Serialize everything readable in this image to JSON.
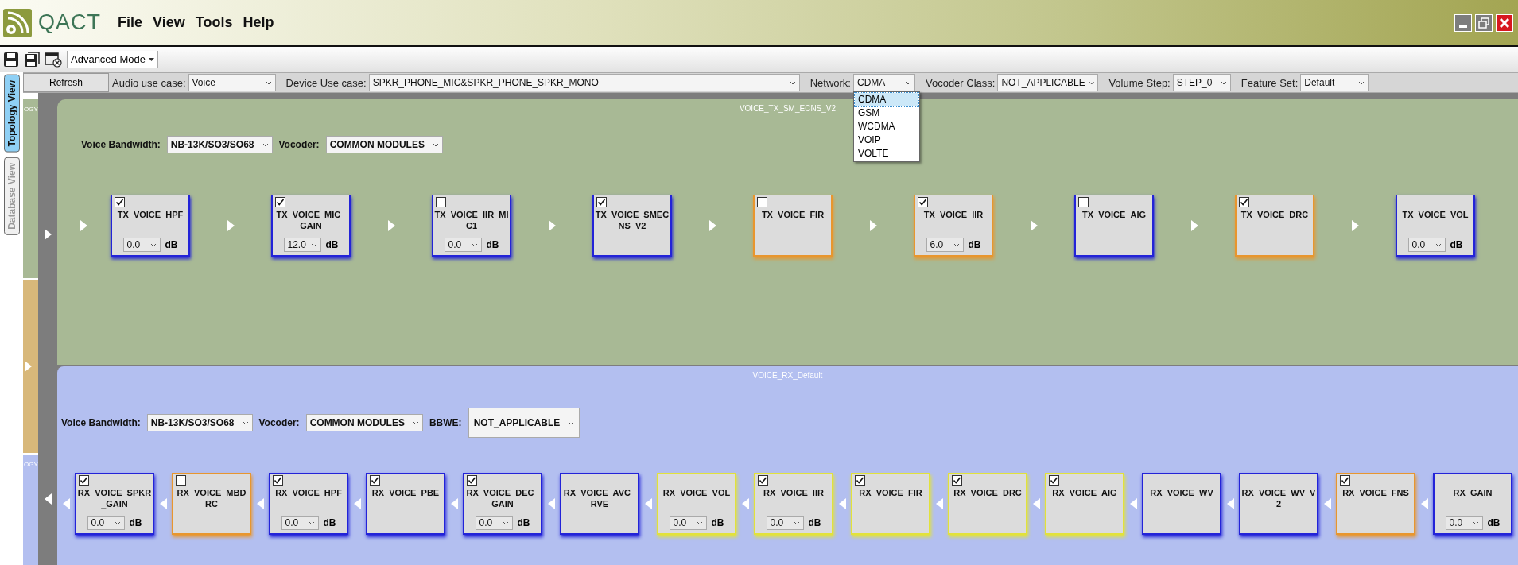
{
  "app": {
    "title": "QACT"
  },
  "menu": [
    "File",
    "View",
    "Tools",
    "Help"
  ],
  "toolbar": {
    "mode": "Advanced Mode"
  },
  "filters": {
    "refresh": "Refresh",
    "fields": [
      {
        "label": "Audio use case:",
        "value": "Voice"
      },
      {
        "label": "Device Use case:",
        "value": "SPKR_PHONE_MIC&SPKR_PHONE_SPKR_MONO"
      },
      {
        "label": "Network:",
        "value": "CDMA",
        "expanded": true,
        "options": [
          {
            "label": "CDMA",
            "selected": true
          },
          {
            "label": "GSM",
            "selected": false
          },
          {
            "label": "WCDMA",
            "selected": false
          },
          {
            "label": "VOIP",
            "selected": false
          },
          {
            "label": "VOLTE",
            "selected": false
          }
        ]
      },
      {
        "label": "Vocoder Class:",
        "value": "NOT_APPLICABLE"
      },
      {
        "label": "Volume Step:",
        "value": "STEP_0"
      },
      {
        "label": "Feature Set:",
        "value": "Default"
      }
    ]
  },
  "side_tabs": [
    {
      "label": "Topology View",
      "selected": true
    },
    {
      "label": "Database View",
      "selected": false
    }
  ],
  "collapsed_tabs": [
    {
      "label": "OGY",
      "kind": "tx"
    },
    {
      "label": "OGY",
      "kind": "rx"
    }
  ],
  "panels": [
    {
      "title": "VOICE_TX_SM_ECNS_V2",
      "kind": "tx",
      "settings": [
        {
          "label": "Voice Bandwidth:",
          "value": "NB-13K/SO3/SO68"
        },
        {
          "label": "Vocoder:",
          "value": "COMMON MODULES"
        }
      ],
      "modules": [
        {
          "name": "TX_VOICE_HPF",
          "kind": "checkbox",
          "checked": true,
          "gain": "0.0",
          "unit": "dB",
          "color": "#2323d8"
        },
        {
          "name": "TX_VOICE_MIC_GAIN",
          "kind": "checkbox",
          "checked": true,
          "gain": "12.0",
          "unit": "dB",
          "color": "#2323d8"
        },
        {
          "name": "TX_VOICE_IIR_MIC1",
          "kind": "checkbox",
          "checked": false,
          "gain": "0.0",
          "unit": "dB",
          "color": "#2323d8"
        },
        {
          "name": "TX_VOICE_SMECNS_V2",
          "kind": "checkbox",
          "checked": true,
          "color": "#2323d8"
        },
        {
          "name": "TX_VOICE_FIR",
          "kind": "checkbox",
          "checked": false,
          "color": "#e8962e"
        },
        {
          "name": "TX_VOICE_IIR",
          "kind": "checkbox",
          "checked": true,
          "gain": "6.0",
          "unit": "dB",
          "color": "#e8962e"
        },
        {
          "name": "TX_VOICE_AIG",
          "kind": "checkbox",
          "checked": false,
          "color": "#2323d8"
        },
        {
          "name": "TX_VOICE_DRC",
          "kind": "checkbox",
          "checked": true,
          "color": "#e8962e"
        },
        {
          "name": "TX_VOICE_VOL",
          "kind": "fixed",
          "gain": "0.0",
          "unit": "dB",
          "color": "#2323d8"
        }
      ]
    },
    {
      "title": "VOICE_RX_Default",
      "kind": "rx",
      "settings": [
        {
          "label": "Voice Bandwidth:",
          "value": "NB-13K/SO3/SO68"
        },
        {
          "label": "Vocoder:",
          "value": "COMMON MODULES"
        },
        {
          "label": "BBWE:",
          "value": "NOT_APPLICABLE"
        }
      ],
      "modules": [
        {
          "name": "RX_VOICE_SPKR_GAIN",
          "kind": "checkbox",
          "checked": true,
          "gain": "0.0",
          "unit": "dB",
          "color": "#2323d8"
        },
        {
          "name": "RX_VOICE_MBDRC",
          "kind": "checkbox",
          "checked": false,
          "color": "#e8962e"
        },
        {
          "name": "RX_VOICE_HPF",
          "kind": "checkbox",
          "checked": true,
          "gain": "0.0",
          "unit": "dB",
          "color": "#2323d8"
        },
        {
          "name": "RX_VOICE_PBE",
          "kind": "checkbox",
          "checked": true,
          "color": "#2323d8"
        },
        {
          "name": "RX_VOICE_DEC_GAIN",
          "kind": "checkbox",
          "checked": true,
          "gain": "0.0",
          "unit": "dB",
          "color": "#2323d8"
        },
        {
          "name": "RX_VOICE_AVC_RVE",
          "kind": "fixed",
          "color": "#2323d8"
        },
        {
          "name": "RX_VOICE_VOL",
          "kind": "fixed",
          "gain": "0.0",
          "unit": "dB",
          "color": "#e2e23a"
        },
        {
          "name": "RX_VOICE_IIR",
          "kind": "checkbox",
          "checked": true,
          "gain": "0.0",
          "unit": "dB",
          "color": "#e2e23a"
        },
        {
          "name": "RX_VOICE_FIR",
          "kind": "checkbox",
          "checked": true,
          "color": "#e2e23a"
        },
        {
          "name": "RX_VOICE_DRC",
          "kind": "checkbox",
          "checked": true,
          "color": "#e2e23a"
        },
        {
          "name": "RX_VOICE_AIG",
          "kind": "checkbox",
          "checked": true,
          "color": "#e2e23a"
        },
        {
          "name": "RX_VOICE_WV",
          "kind": "fixed",
          "color": "#2323d8"
        },
        {
          "name": "RX_VOICE_WV_V2",
          "kind": "fixed",
          "color": "#2323d8"
        },
        {
          "name": "RX_VOICE_FNS",
          "kind": "checkbox",
          "checked": true,
          "color": "#e8962e"
        },
        {
          "name": "RX_GAIN",
          "kind": "fixed",
          "gain": "0.0",
          "unit": "dB",
          "color": "#2323d8"
        }
      ]
    }
  ]
}
